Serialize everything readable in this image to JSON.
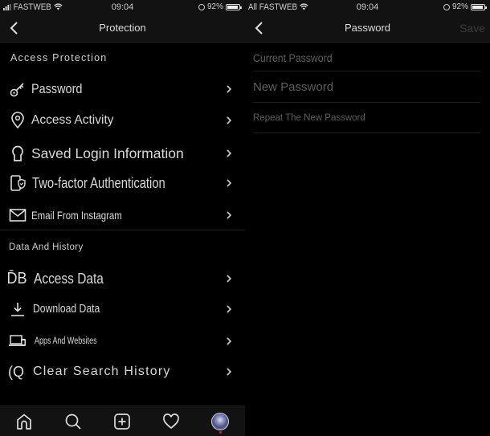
{
  "left_screen": {
    "status": {
      "carrier": "FASTWEB",
      "time": "09:04",
      "battery": "92%"
    },
    "nav": {
      "title": "Protection"
    },
    "sections": [
      {
        "title": "Access Protection",
        "items": [
          {
            "label": "Password",
            "icon": "key-icon"
          },
          {
            "label": "Access Activity",
            "icon": "location-pin-icon"
          },
          {
            "label": "Saved Login Information",
            "icon": "keyhole-icon"
          },
          {
            "label": "Two-factor Authentication",
            "icon": "phone-shield-icon"
          },
          {
            "label": "Email From Instagram",
            "icon": "envelope-icon"
          }
        ]
      },
      {
        "title": "Data And History",
        "items": [
          {
            "label": "Access Data",
            "icon": "database-icon"
          },
          {
            "label": "Download Data",
            "icon": "download-icon"
          },
          {
            "label": "Apps And Websites",
            "icon": "devices-icon"
          },
          {
            "label": "Clear Search History",
            "icon": "search-history-icon"
          }
        ]
      }
    ],
    "tabbar": [
      {
        "name": "home",
        "icon": "home-icon"
      },
      {
        "name": "search",
        "icon": "search-icon"
      },
      {
        "name": "new-post",
        "icon": "plus-square-icon"
      },
      {
        "name": "activity",
        "icon": "heart-icon"
      },
      {
        "name": "profile",
        "icon": "avatar-icon"
      }
    ]
  },
  "right_screen": {
    "status": {
      "carrier": "All FASTWEB",
      "time": "09:04",
      "battery": "92%"
    },
    "nav": {
      "title": "Password",
      "save_label": "Save"
    },
    "fields": [
      {
        "placeholder": "Current Password",
        "value": ""
      },
      {
        "placeholder": "New Password",
        "value": ""
      },
      {
        "placeholder": "Repeat The New Password",
        "value": ""
      }
    ]
  },
  "colors": {
    "background": "#000000",
    "bar": "#121212",
    "text": "#d8d8d8",
    "save_disabled": "#3c3c3c"
  }
}
